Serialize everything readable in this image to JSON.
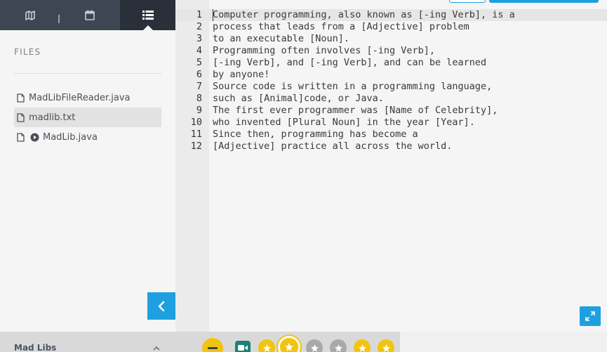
{
  "sidebar": {
    "heading": "FILES",
    "files": [
      {
        "name": "MadLibFileReader.java",
        "icon": "file-icon",
        "active": false
      },
      {
        "name": "madlib.txt",
        "icon": "file-icon",
        "active": true
      },
      {
        "name": "MadLib.java",
        "icon": "file-icon",
        "active": false,
        "run_icon": "play-circle-icon"
      }
    ],
    "footer_title": "Mad Libs"
  },
  "nav": {
    "tabs": [
      {
        "icon": "map-icon"
      },
      {
        "icon": "calendar-icon"
      },
      {
        "icon": "list-icon",
        "active": true
      }
    ]
  },
  "editor": {
    "lines": [
      {
        "n": "1",
        "text": "Computer programming, also known as [-ing Verb], is a"
      },
      {
        "n": "2",
        "text": "process that leads from a [Adjective] problem"
      },
      {
        "n": "3",
        "text": "to an executable [Noun]."
      },
      {
        "n": "4",
        "text": "Programming often involves [-ing Verb],"
      },
      {
        "n": "5",
        "text": "[-ing Verb], and [-ing Verb], and can be learned"
      },
      {
        "n": "6",
        "text": "by anyone!"
      },
      {
        "n": "7",
        "text": "Source code is written in a programming language,"
      },
      {
        "n": "8",
        "text": "such as [Animal]code, or Java."
      },
      {
        "n": "9",
        "text": "The first ever programmer was [Name of Celebrity],"
      },
      {
        "n": "10",
        "text": "who invented [Plural Noun] in the year [Year]."
      },
      {
        "n": "11",
        "text": "Since then, programming has become a"
      },
      {
        "n": "12",
        "text": "[Adjective] practice all across the world."
      }
    ]
  },
  "toolbar": {
    "tools": [
      "minus-circle-icon",
      "video-icon",
      "star-icon",
      "star-icon",
      "star-icon",
      "star-icon",
      "star-icon",
      "star-icon"
    ]
  },
  "colors": {
    "accent": "#1ea0e0",
    "nav_bg": "#3d4652",
    "nav_active": "#2a3039",
    "star_yellow": "#f2c411",
    "star_gray": "#a9a9a9",
    "video_teal": "#1f7f76"
  }
}
